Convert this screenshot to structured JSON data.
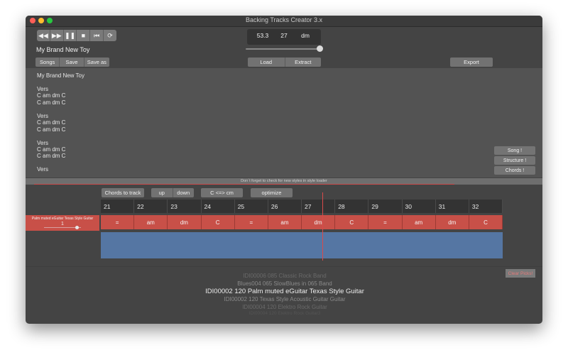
{
  "window": {
    "title": "Backing Tracks Creator 3.x"
  },
  "transport": {
    "buttons": [
      {
        "name": "rewind-icon",
        "glyph": "◀◀"
      },
      {
        "name": "fast-forward-icon",
        "glyph": "▶▶"
      },
      {
        "name": "pause-icon",
        "glyph": "❚❚"
      },
      {
        "name": "stop-icon",
        "glyph": "■"
      },
      {
        "name": "back-to-start-icon",
        "glyph": "⏮"
      },
      {
        "name": "loop-icon",
        "glyph": "⟳"
      }
    ]
  },
  "tempo": {
    "bpm": "53.3",
    "bars": "27",
    "key": "dm"
  },
  "song": {
    "title": "My Brand New Toy"
  },
  "toolbar": {
    "songs": "Songs",
    "save": "Save",
    "save_as": "Save as",
    "load": "Load",
    "extract": "Extract",
    "export": "Export"
  },
  "editor": {
    "lines": [
      "My Brand New Toy",
      "",
      "Vers",
      "C am dm C",
      "C am dm C",
      "",
      "Vers",
      "C am dm C",
      "C am dm C",
      "",
      "Vers",
      "C am dm C",
      "C am dm C",
      "",
      "Vers"
    ]
  },
  "side_buttons": {
    "song": "Song !",
    "structure": "Structure !",
    "chords": "Chords !"
  },
  "status": {
    "message": "Don´t forget to check for new styles in style loader"
  },
  "grid_toolbar": {
    "chords_to_track": "Chords to track",
    "up": "up",
    "down": "down",
    "convert": "C <=> cm",
    "optimize": "optimize"
  },
  "grid": {
    "bars": [
      "21",
      "22",
      "23",
      "24",
      "25",
      "26",
      "27",
      "28",
      "29",
      "30",
      "31",
      "32"
    ],
    "chords": [
      "=",
      "am",
      "dm",
      "C",
      "=",
      "am",
      "dm",
      "C",
      "=",
      "am",
      "dm",
      "C"
    ]
  },
  "track": {
    "name": "Palm muted eGuitar Texas Style Guitar",
    "volume": "1"
  },
  "styles": {
    "items": [
      "IDI00006 085 Classic Rock Band",
      "Blues004 065 SlowBlues in 065 Band",
      "IDI00002 120 Palm muted eGuitar Texas Style Guitar",
      "IDI00002 120 Texas Style Acoustic Guitar Guitar",
      "IDI00004 120 Elektro Rock Guitar",
      "IDI00004 120 Elektro Rock Guitar3"
    ],
    "clear_picks": "Clear Picks!"
  },
  "colors": {
    "chord_row": "#c85048",
    "track_area": "#5576a3",
    "playhead": "#d94a4a"
  }
}
